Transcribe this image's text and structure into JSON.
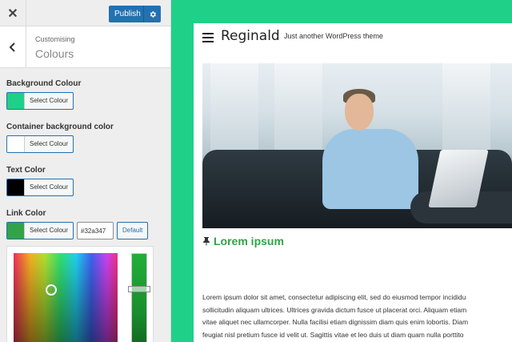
{
  "toolbar": {
    "close_icon": "close-icon",
    "publish_label": "Publish",
    "settings_icon": "gear-icon"
  },
  "section": {
    "breadcrumb": "Customising",
    "title": "Colours"
  },
  "controls": [
    {
      "label": "Background Colour",
      "button_label": "Select Colour",
      "swatch": "#1fd088"
    },
    {
      "label": "Container background color",
      "button_label": "Select Colour",
      "swatch": "#ffffff"
    },
    {
      "label": "Text Color",
      "button_label": "Select Colour",
      "swatch": "#000000"
    },
    {
      "label": "Link Color",
      "button_label": "Select Colour",
      "swatch": "#32a347",
      "hex_value": "#32a347",
      "default_label": "Default"
    }
  ],
  "preview": {
    "site_title": "Reginald",
    "tagline": "Just another WordPress theme",
    "post_title": "Lorem ipsum",
    "post_lines": [
      "Lorem ipsum dolor sit amet, consectetur adipiscing elit, sed do eiusmod tempor incididu",
      "sollicitudin aliquam ultrices. Ultrices gravida dictum fusce ut placerat orci. Aliquam etiam",
      "vitae aliquet nec ullamcorper. Nulla facilisi etiam dignissim diam quis enim lobortis. Diam",
      "feugiat nisl pretium fusce id velit ut. Sagittis vitae et leo duis ut diam quam nulla porttito"
    ]
  },
  "colors": {
    "accent": "#2271b1",
    "page_background": "#1fd088",
    "link": "#32a347"
  }
}
